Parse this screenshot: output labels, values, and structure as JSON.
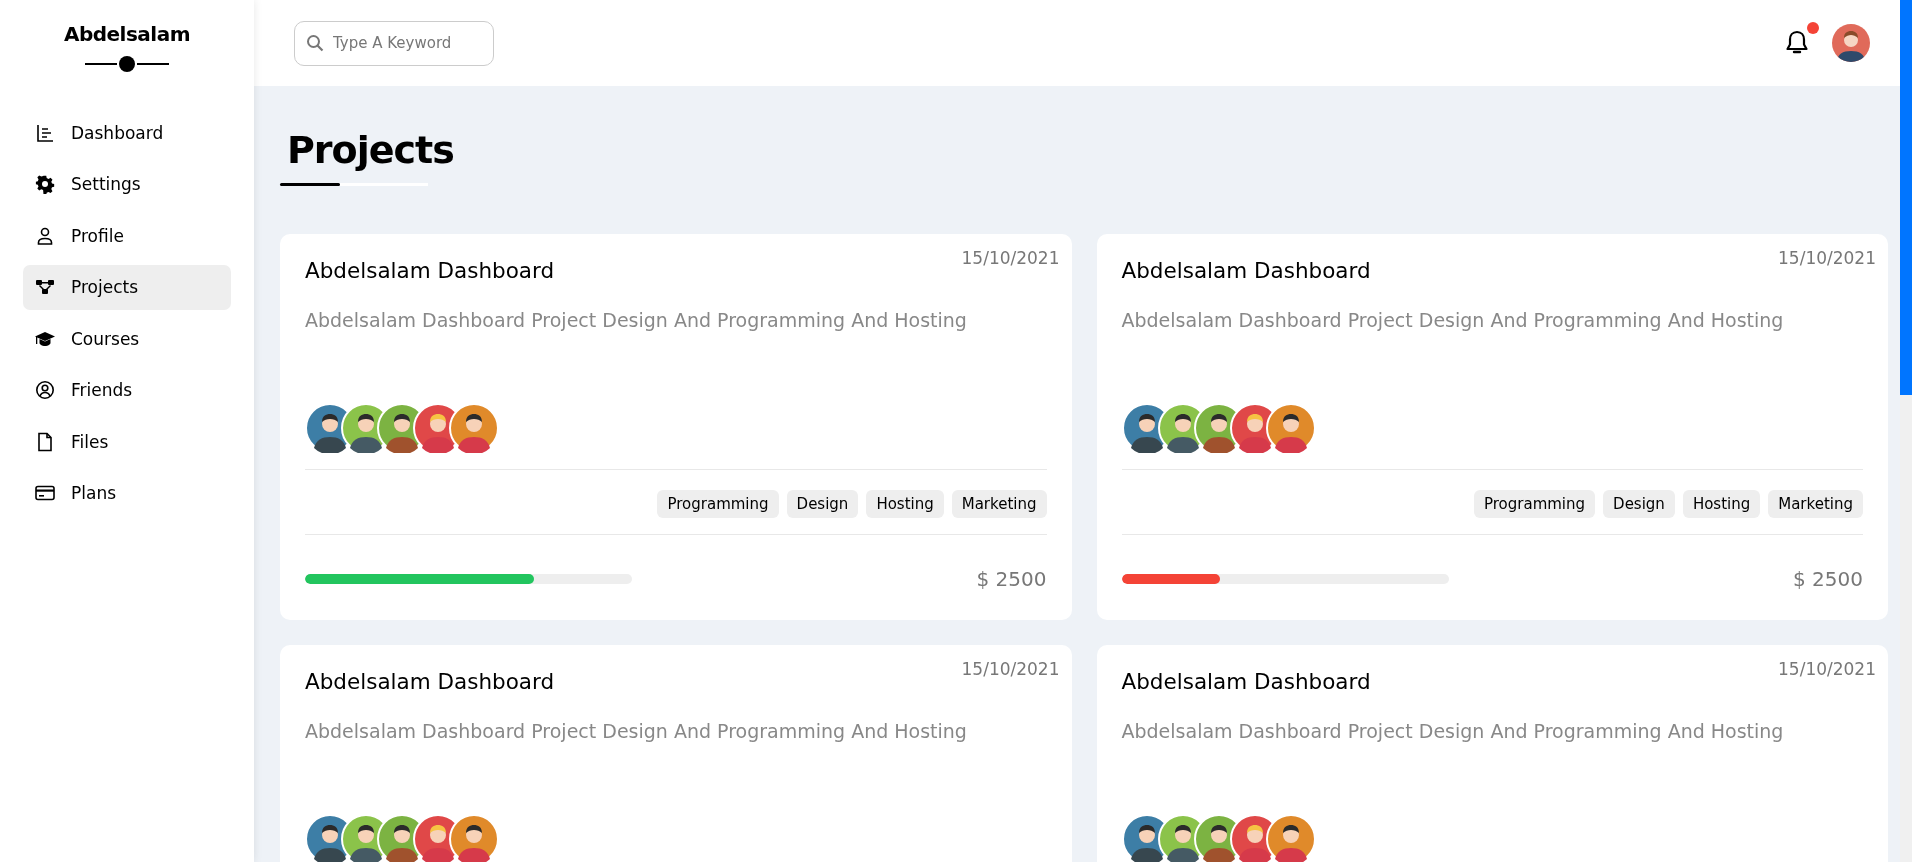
{
  "sidebar": {
    "brand": "Abdelsalam",
    "items": [
      {
        "label": "Dashboard",
        "selected": false
      },
      {
        "label": "Settings",
        "selected": false
      },
      {
        "label": "Profile",
        "selected": false
      },
      {
        "label": "Projects",
        "selected": true
      },
      {
        "label": "Courses",
        "selected": false
      },
      {
        "label": "Friends",
        "selected": false
      },
      {
        "label": "Files",
        "selected": false
      },
      {
        "label": "Plans",
        "selected": false
      }
    ]
  },
  "header": {
    "search": {
      "placeholder": "Type A Keyword"
    },
    "notifications": {
      "unread": true
    }
  },
  "page_title": "Projects",
  "projects": [
    {
      "title": "Abdelsalam Dashboard",
      "date": "15/10/2021",
      "description": "Abdelsalam Dashboard Project Design And Programming And Hosting",
      "tags": [
        "Programming",
        "Design",
        "Hosting",
        "Marketing"
      ],
      "progress": {
        "level": 0.7,
        "color": "#22c55e"
      },
      "price": "$ 2500"
    },
    {
      "title": "Abdelsalam Dashboard",
      "date": "15/10/2021",
      "description": "Abdelsalam Dashboard Project Design And Programming And Hosting",
      "tags": [
        "Programming",
        "Design",
        "Hosting",
        "Marketing"
      ],
      "progress": {
        "level": 0.3,
        "color": "#f44336"
      },
      "price": "$ 2500"
    },
    {
      "title": "Abdelsalam Dashboard",
      "date": "15/10/2021",
      "description": "Abdelsalam Dashboard Project Design And Programming And Hosting"
    },
    {
      "title": "Abdelsalam Dashboard",
      "date": "15/10/2021",
      "description": "Abdelsalam Dashboard Project Design And Programming And Hosting"
    }
  ]
}
